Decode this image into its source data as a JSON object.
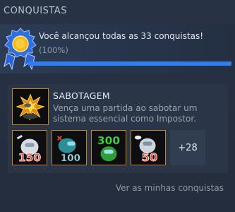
{
  "section": {
    "title": "CONQUISTAS"
  },
  "summary": {
    "text": "Você alcançou todas as 33 conquistas!",
    "percent_text": "(100%)",
    "progress_fraction": 1.0
  },
  "featured": {
    "name": "SABOTAGEM",
    "description": "Vença uma partida ao sabotar um sistema essencial como Impostor.",
    "icon": "explosion-icon"
  },
  "thumbnails": [
    {
      "icon": "achievement-150-icon",
      "label": "150"
    },
    {
      "icon": "achievement-100-icon",
      "label": "100"
    },
    {
      "icon": "achievement-300-icon",
      "label": "300"
    },
    {
      "icon": "achievement-50-icon",
      "label": "50"
    }
  ],
  "more_count": "+28",
  "footer_link": "Ver as minhas conquistas",
  "colors": {
    "accent": "#2e7ef2",
    "gold_border": "#b9872c",
    "background": "#1b2838"
  }
}
